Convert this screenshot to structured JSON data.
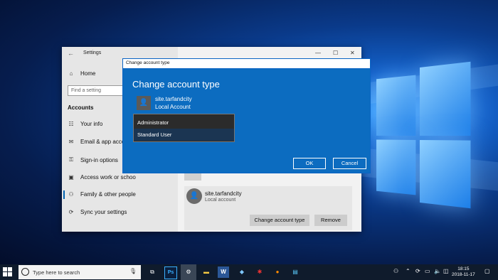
{
  "settings": {
    "title": "Settings",
    "home": "Home",
    "search_placeholder": "Find a setting",
    "section": "Accounts",
    "nav": [
      {
        "label": "Your info",
        "icon": "person-card-icon"
      },
      {
        "label": "Email & app accou",
        "icon": "mail-icon"
      },
      {
        "label": "Sign-in options",
        "icon": "key-icon"
      },
      {
        "label": "Access work or schoo",
        "icon": "briefcase-icon"
      },
      {
        "label": "Family & other people",
        "icon": "people-icon"
      },
      {
        "label": "Sync your settings",
        "icon": "sync-icon"
      }
    ],
    "user_name": "site.tarfandcity",
    "user_type": "Local account",
    "change_btn": "Change account type",
    "remove_btn": "Remove"
  },
  "dialog": {
    "window_title": "Change account type",
    "heading": "Change account type",
    "user_name": "site.tarfandcity",
    "user_type": "Local Account",
    "options": [
      "Administrator",
      "Standard User"
    ],
    "selected": "Standard User",
    "ok": "OK",
    "cancel": "Cancel"
  },
  "taskbar": {
    "search_placeholder": "Type here to search",
    "time": "18:15",
    "date": "2018-11-17"
  },
  "colors": {
    "accent": "#0c6cc0",
    "taskbar": "#0f1b2c"
  }
}
